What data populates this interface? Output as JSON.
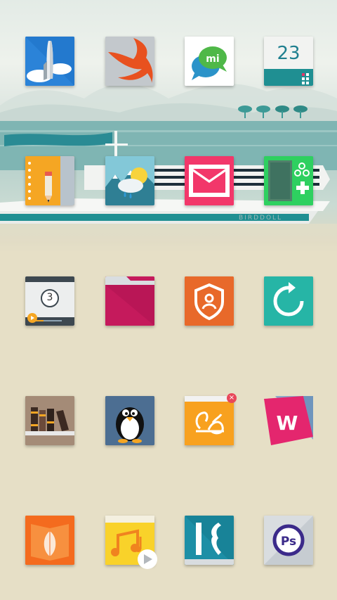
{
  "colors": {
    "background": "#e6dfc6",
    "sea": "#7fb5b3",
    "ship_teal": "#1f8f92",
    "banner": "#2a8b94"
  },
  "wallpaper": {
    "ship_name": "BIRDDOLL"
  },
  "calendar": {
    "day": "23"
  },
  "clock_app": {
    "countdown_digit": "3"
  },
  "icons": [
    {
      "name": "rocket-launcher-icon"
    },
    {
      "name": "swift-bird-icon"
    },
    {
      "name": "mi-chat-icon",
      "text": "mi"
    },
    {
      "name": "calendar-icon"
    },
    {
      "name": "notebook-pencil-icon"
    },
    {
      "name": "weather-icon"
    },
    {
      "name": "email-icon"
    },
    {
      "name": "gamepad-icon"
    },
    {
      "name": "video-player-icon"
    },
    {
      "name": "folder-icon"
    },
    {
      "name": "security-shield-icon"
    },
    {
      "name": "sync-icon"
    },
    {
      "name": "bookshelf-icon"
    },
    {
      "name": "penguin-icon"
    },
    {
      "name": "uc-browser-icon"
    },
    {
      "name": "w-card-icon",
      "text": "W"
    },
    {
      "name": "book-reader-icon"
    },
    {
      "name": "music-player-icon"
    },
    {
      "name": "k-launcher-icon"
    },
    {
      "name": "photoshop-express-icon",
      "text": "Ps"
    }
  ]
}
